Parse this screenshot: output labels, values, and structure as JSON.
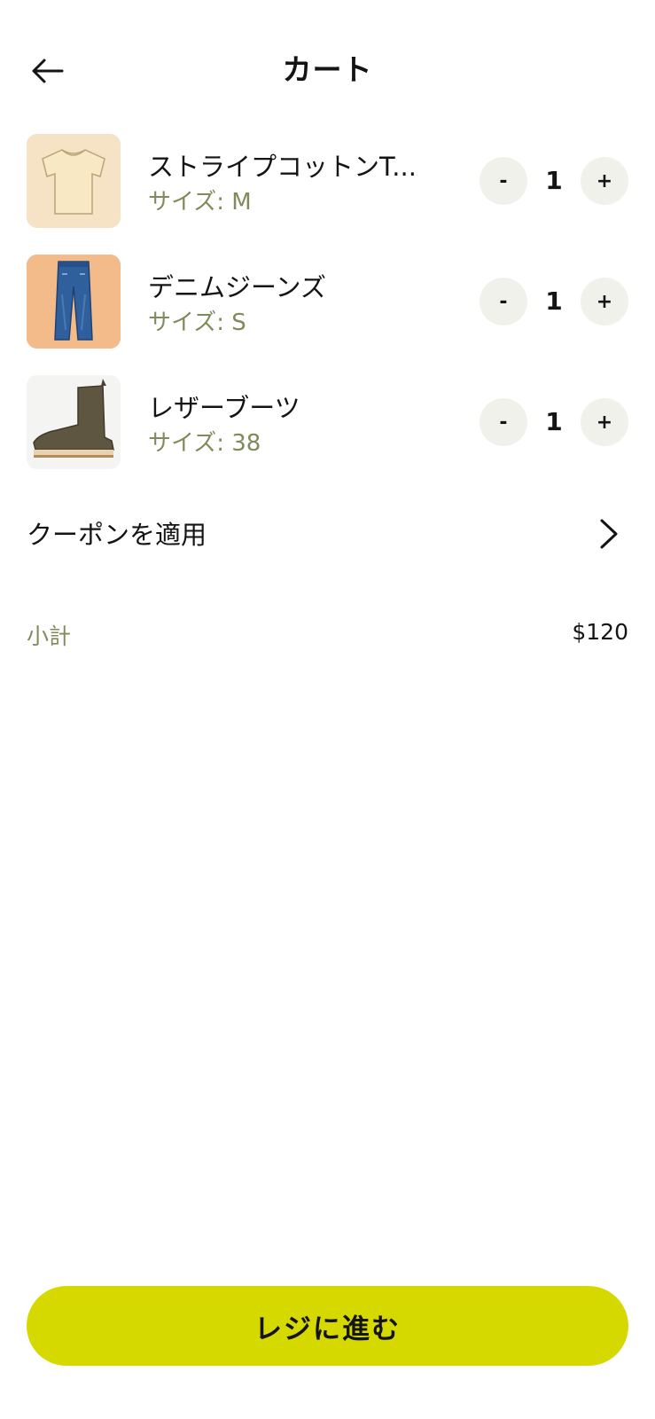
{
  "header": {
    "title": "カート",
    "back_icon": "arrow-left-icon"
  },
  "cart": {
    "items": [
      {
        "name": "ストライプコットンT...",
        "size_label": "サイズ:",
        "size_value": "M",
        "quantity": "1",
        "minus_label": "-",
        "plus_label": "+",
        "image": "t-shirt-image",
        "image_bg": "#f6e3c6"
      },
      {
        "name": "デニムジーンズ",
        "size_label": "サイズ:",
        "size_value": "S",
        "quantity": "1",
        "minus_label": "-",
        "plus_label": "+",
        "image": "jeans-image",
        "image_bg": "#f3bb89"
      },
      {
        "name": "レザーブーツ",
        "size_label": "サイズ:",
        "size_value": "38",
        "quantity": "1",
        "minus_label": "-",
        "plus_label": "+",
        "image": "leather-boot-image",
        "image_bg": "#f4f4f2"
      }
    ]
  },
  "coupon": {
    "label": "クーポンを適用",
    "icon": "chevron-right-icon"
  },
  "summary": {
    "subtotal_label": "小計",
    "subtotal_value": "$120"
  },
  "checkout": {
    "label": "レジに進む"
  },
  "colors": {
    "accent": "#d6d900",
    "muted_text": "#7f8b5a",
    "stepper_bg": "#f1f1ec",
    "text": "#141414"
  }
}
